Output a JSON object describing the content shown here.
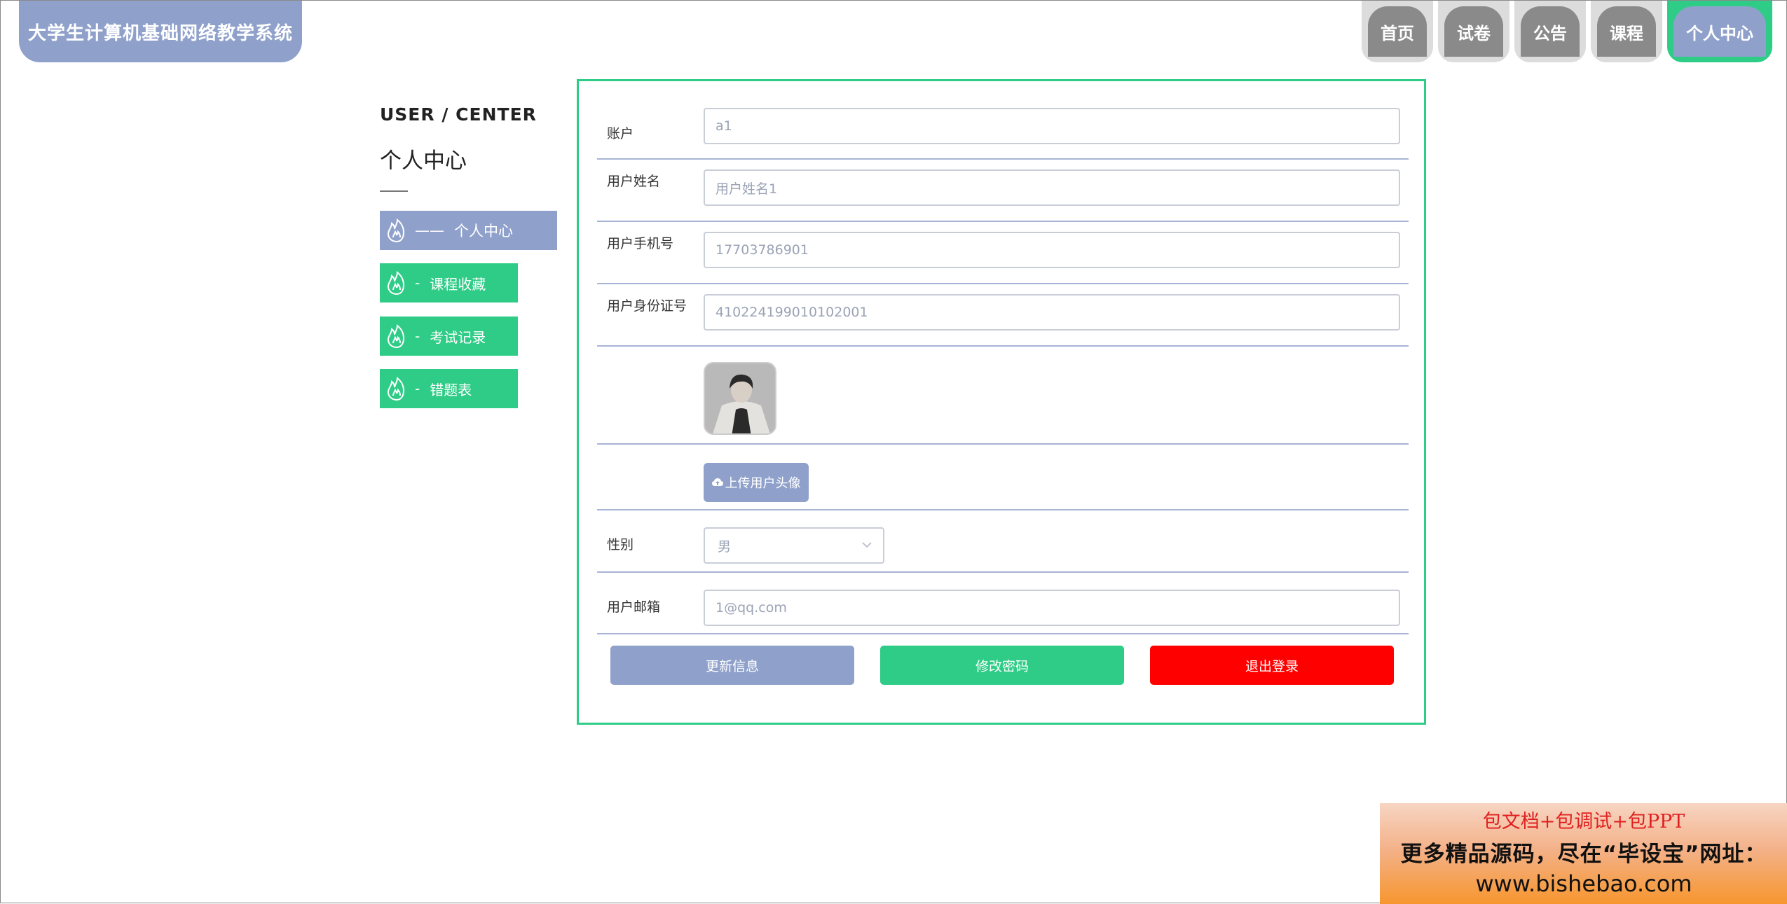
{
  "header": {
    "brand": "大学生计算机基础网络教学系统",
    "nav": [
      {
        "label": "首页",
        "active": false
      },
      {
        "label": "试卷",
        "active": false
      },
      {
        "label": "公告",
        "active": false
      },
      {
        "label": "课程",
        "active": false
      },
      {
        "label": "个人中心",
        "active": true
      }
    ]
  },
  "sidebar": {
    "title_en": "USER / CENTER",
    "title_cn": "个人中心",
    "items": [
      {
        "label": "个人中心",
        "active": true
      },
      {
        "label": "课程收藏",
        "active": false
      },
      {
        "label": "考试记录",
        "active": false
      },
      {
        "label": "错题表",
        "active": false
      }
    ]
  },
  "form": {
    "account": {
      "label": "账户",
      "value": "a1"
    },
    "name": {
      "label": "用户姓名",
      "value": "用户姓名1"
    },
    "phone": {
      "label": "用户手机号",
      "value": "17703786901"
    },
    "idcard": {
      "label": "用户身份证号",
      "value": "410224199010102001"
    },
    "upload_label": "上传用户头像",
    "gender": {
      "label": "性别",
      "value": "男"
    },
    "email": {
      "label": "用户邮箱",
      "value": "1@qq.com"
    }
  },
  "buttons": {
    "update": "更新信息",
    "change_password": "修改密码",
    "logout": "退出登录"
  },
  "colors": {
    "primary": "#8fa1cb",
    "accent": "#2ecc86",
    "danger": "#ff0000"
  },
  "ad": {
    "line1": "包文档+包调试+包PPT",
    "line2": "更多精品源码，尽在“毕设宝”网址：",
    "line3": "www.bishebao.com"
  }
}
